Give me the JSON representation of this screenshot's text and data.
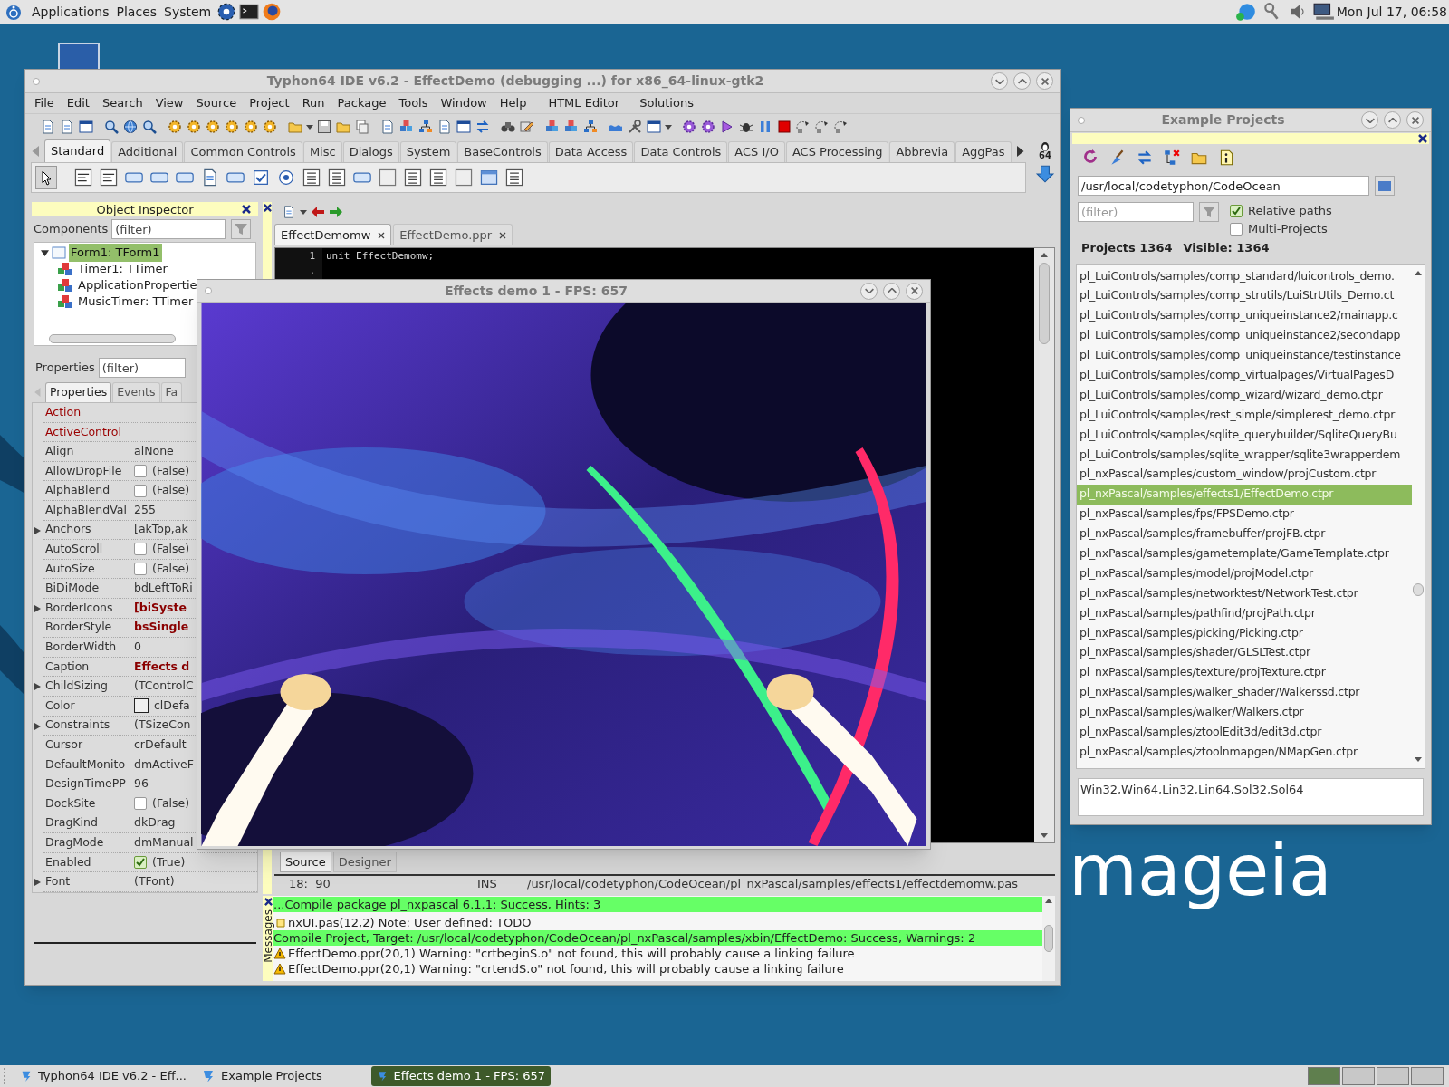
{
  "top_panel": {
    "menus": [
      "Applications",
      "Places",
      "System"
    ],
    "clock": "Mon Jul 17, 06:58"
  },
  "desktop": {
    "logo_text": "mageia"
  },
  "ide": {
    "title": "Typhon64 IDE v6.2 - EffectDemo (debugging ...) for x86_64-linux-gtk2",
    "menu": [
      "File",
      "Edit",
      "Search",
      "View",
      "Source",
      "Project",
      "Run",
      "Package",
      "Tools",
      "Window",
      "Help",
      "HTML Editor",
      "Solutions"
    ],
    "palette_tabs": [
      {
        "label": "Standard",
        "selected": true
      },
      {
        "label": "Additional",
        "selected": false
      },
      {
        "label": "Common Controls",
        "selected": false
      },
      {
        "label": "Misc",
        "selected": false
      },
      {
        "label": "Dialogs",
        "selected": false
      },
      {
        "label": "System",
        "selected": false
      },
      {
        "label": "BaseControls",
        "selected": false
      },
      {
        "label": "Data Access",
        "selected": false
      },
      {
        "label": "Data Controls",
        "selected": false
      },
      {
        "label": "ACS I/O",
        "selected": false
      },
      {
        "label": "ACS Processing",
        "selected": false
      },
      {
        "label": "Abbrevia",
        "selected": false
      },
      {
        "label": "AggPas",
        "selected": false
      }
    ],
    "bits_badge": "64",
    "object_inspector": {
      "title": "Object Inspector",
      "components_label": "Components",
      "components_filter": {
        "placeholder": "(filter)"
      },
      "tree": [
        {
          "label": "Form1: TForm1",
          "selected": true,
          "expanded": true,
          "children": [
            {
              "label": "Timer1: TTimer",
              "selected": false
            },
            {
              "label": "ApplicationPropertie",
              "selected": false
            },
            {
              "label": "MusicTimer: TTimer",
              "selected": false
            }
          ]
        }
      ],
      "properties_label": "Properties",
      "properties_filter": {
        "placeholder": "(filter)"
      },
      "tabs": [
        {
          "label": "Properties",
          "selected": true
        },
        {
          "label": "Events",
          "selected": false
        },
        {
          "label": "Fa",
          "selected": false
        }
      ],
      "properties": [
        {
          "name": "Action",
          "kind": "text",
          "reference": true,
          "expandable": false
        },
        {
          "name": "ActiveControl",
          "kind": "text",
          "reference": true,
          "expandable": false
        },
        {
          "name": "Align",
          "value": "alNone",
          "kind": "text",
          "reference": false,
          "modified": false,
          "expandable": false
        },
        {
          "name": "AllowDropFile",
          "value": "(False)",
          "kind": "bool",
          "checked": false,
          "reference": false,
          "modified": false,
          "expandable": false
        },
        {
          "name": "AlphaBlend",
          "value": "(False)",
          "kind": "bool",
          "checked": false,
          "reference": false,
          "modified": false,
          "expandable": false
        },
        {
          "name": "AlphaBlendVal",
          "value": "255",
          "kind": "text",
          "reference": false,
          "modified": false,
          "expandable": false
        },
        {
          "name": "Anchors",
          "value": "[akTop,ak",
          "kind": "text",
          "reference": false,
          "modified": false,
          "expandable": true
        },
        {
          "name": "AutoScroll",
          "value": "(False)",
          "kind": "bool",
          "checked": false,
          "reference": false,
          "modified": false,
          "expandable": false
        },
        {
          "name": "AutoSize",
          "value": "(False)",
          "kind": "bool",
          "checked": false,
          "reference": false,
          "modified": false,
          "expandable": false
        },
        {
          "name": "BiDiMode",
          "value": "bdLeftToRi",
          "kind": "text",
          "reference": false,
          "modified": false,
          "expandable": false
        },
        {
          "name": "BorderIcons",
          "value": "[biSyste",
          "kind": "text",
          "reference": false,
          "modified": true,
          "expandable": true
        },
        {
          "name": "BorderStyle",
          "value": "bsSingle",
          "kind": "text",
          "reference": false,
          "modified": true,
          "expandable": false
        },
        {
          "name": "BorderWidth",
          "value": "0",
          "kind": "text",
          "reference": false,
          "modified": false,
          "expandable": false
        },
        {
          "name": "Caption",
          "value": "Effects d",
          "kind": "text",
          "reference": false,
          "modified": true,
          "expandable": false
        },
        {
          "name": "ChildSizing",
          "value": "(TControlC",
          "kind": "text",
          "reference": false,
          "modified": false,
          "expandable": true
        },
        {
          "name": "Color",
          "value": "clDefa",
          "kind": "color",
          "reference": false,
          "modified": false,
          "expandable": false
        },
        {
          "name": "Constraints",
          "value": "(TSizeCon",
          "kind": "text",
          "reference": false,
          "modified": false,
          "expandable": true
        },
        {
          "name": "Cursor",
          "value": "crDefault",
          "kind": "text",
          "reference": false,
          "modified": false,
          "expandable": false
        },
        {
          "name": "DefaultMonito",
          "value": "dmActiveF",
          "kind": "text",
          "reference": false,
          "modified": false,
          "expandable": false
        },
        {
          "name": "DesignTimePP",
          "value": "96",
          "kind": "text",
          "reference": false,
          "modified": false,
          "expandable": false
        },
        {
          "name": "DockSite",
          "value": "(False)",
          "kind": "bool",
          "checked": false,
          "reference": false,
          "modified": false,
          "expandable": false
        },
        {
          "name": "DragKind",
          "value": "dkDrag",
          "kind": "text",
          "reference": false,
          "modified": false,
          "expandable": false
        },
        {
          "name": "DragMode",
          "value": "dmManual",
          "kind": "text",
          "reference": false,
          "modified": false,
          "expandable": false
        },
        {
          "name": "Enabled",
          "value": "(True)",
          "kind": "bool",
          "checked": true,
          "reference": false,
          "modified": false,
          "expandable": false
        },
        {
          "name": "Font",
          "value": "(TFont)",
          "kind": "text",
          "reference": false,
          "modified": false,
          "expandable": true
        }
      ]
    },
    "editor": {
      "tabs": [
        {
          "label": "EffectDemomw",
          "selected": true
        },
        {
          "label": "EffectDemo.ppr",
          "selected": false
        }
      ],
      "lines": [
        {
          "number": "1",
          "text": "unit EffectDemomw;"
        },
        {
          "number": "."
        }
      ],
      "view_tabs": [
        {
          "label": "Source",
          "selected": true
        },
        {
          "label": "Designer",
          "selected": false
        }
      ],
      "status": {
        "position": "18:  90",
        "mode": "INS",
        "file": "/usr/local/codetyphon/CodeOcean/pl_nxPascal/samples/effects1/effectdemomw.pas"
      }
    },
    "messages": {
      "title": "Messages",
      "rows": [
        {
          "text": "...Compile package pl_nxpascal 6.1.1: Success, Hints: 3",
          "kind": "success"
        },
        {
          "text": "nxUI.pas(12,2) Note: User defined: TODO",
          "kind": "note"
        },
        {
          "text": "Compile Project, Target: /usr/local/codetyphon/CodeOcean/pl_nxPascal/samples/xbin/EffectDemo: Success, Warnings: 2",
          "kind": "success"
        },
        {
          "text": "EffectDemo.ppr(20,1) Warning: \"crtbeginS.o\" not found, this will probably cause a linking failure",
          "kind": "warning"
        },
        {
          "text": "EffectDemo.ppr(20,1) Warning: \"crtendS.o\" not found, this will probably cause a linking failure",
          "kind": "warning"
        }
      ]
    }
  },
  "effects_window": {
    "title": "Effects demo 1 - FPS: 657"
  },
  "example_projects": {
    "title": "Example Projects",
    "path": "/usr/local/codetyphon/CodeOcean",
    "filter": {
      "placeholder": "(filter)"
    },
    "options": [
      {
        "label": "Relative paths",
        "checked": true
      },
      {
        "label": "Multi-Projects",
        "checked": false
      }
    ],
    "projects_count": "Projects 1364",
    "visible_count": "Visible: 1364",
    "items": [
      {
        "label": "pl_LuiControls/samples/comp_standard/luicontrols_demo.",
        "selected": false
      },
      {
        "label": "pl_LuiControls/samples/comp_strutils/LuiStrUtils_Demo.ct",
        "selected": false
      },
      {
        "label": "pl_LuiControls/samples/comp_uniqueinstance2/mainapp.c",
        "selected": false
      },
      {
        "label": "pl_LuiControls/samples/comp_uniqueinstance2/secondapp",
        "selected": false
      },
      {
        "label": "pl_LuiControls/samples/comp_uniqueinstance/testinstance",
        "selected": false
      },
      {
        "label": "pl_LuiControls/samples/comp_virtualpages/VirtualPagesD",
        "selected": false
      },
      {
        "label": "pl_LuiControls/samples/comp_wizard/wizard_demo.ctpr",
        "selected": false
      },
      {
        "label": "pl_LuiControls/samples/rest_simple/simplerest_demo.ctpr",
        "selected": false
      },
      {
        "label": "pl_LuiControls/samples/sqlite_querybuilder/SqliteQueryBu",
        "selected": false
      },
      {
        "label": "pl_LuiControls/samples/sqlite_wrapper/sqlite3wrapperdem",
        "selected": false
      },
      {
        "label": "pl_nxPascal/samples/custom_window/projCustom.ctpr",
        "selected": false
      },
      {
        "label": "pl_nxPascal/samples/effects1/EffectDemo.ctpr",
        "selected": true
      },
      {
        "label": "pl_nxPascal/samples/fps/FPSDemo.ctpr",
        "selected": false
      },
      {
        "label": "pl_nxPascal/samples/framebuffer/projFB.ctpr",
        "selected": false
      },
      {
        "label": "pl_nxPascal/samples/gametemplate/GameTemplate.ctpr",
        "selected": false
      },
      {
        "label": "pl_nxPascal/samples/model/projModel.ctpr",
        "selected": false
      },
      {
        "label": "pl_nxPascal/samples/networktest/NetworkTest.ctpr",
        "selected": false
      },
      {
        "label": "pl_nxPascal/samples/pathfind/projPath.ctpr",
        "selected": false
      },
      {
        "label": "pl_nxPascal/samples/picking/Picking.ctpr",
        "selected": false
      },
      {
        "label": "pl_nxPascal/samples/shader/GLSLTest.ctpr",
        "selected": false
      },
      {
        "label": "pl_nxPascal/samples/texture/projTexture.ctpr",
        "selected": false
      },
      {
        "label": "pl_nxPascal/samples/walker_shader/Walkerssd.ctpr",
        "selected": false
      },
      {
        "label": "pl_nxPascal/samples/walker/Walkers.ctpr",
        "selected": false
      },
      {
        "label": "pl_nxPascal/samples/ztoolEdit3d/edit3d.ctpr",
        "selected": false
      },
      {
        "label": "pl_nxPascal/samples/ztoolnmapgen/NMapGen.ctpr",
        "selected": false
      }
    ],
    "platforms": "Win32,Win64,Lin32,Lin64,Sol32,Sol64"
  },
  "taskbar": {
    "items": [
      {
        "label": "Typhon64 IDE v6.2 - Eff...",
        "selected": false
      },
      {
        "label": "Example Projects",
        "selected": false
      },
      {
        "label": "Effects demo 1 - FPS: 657",
        "selected": true
      }
    ]
  }
}
